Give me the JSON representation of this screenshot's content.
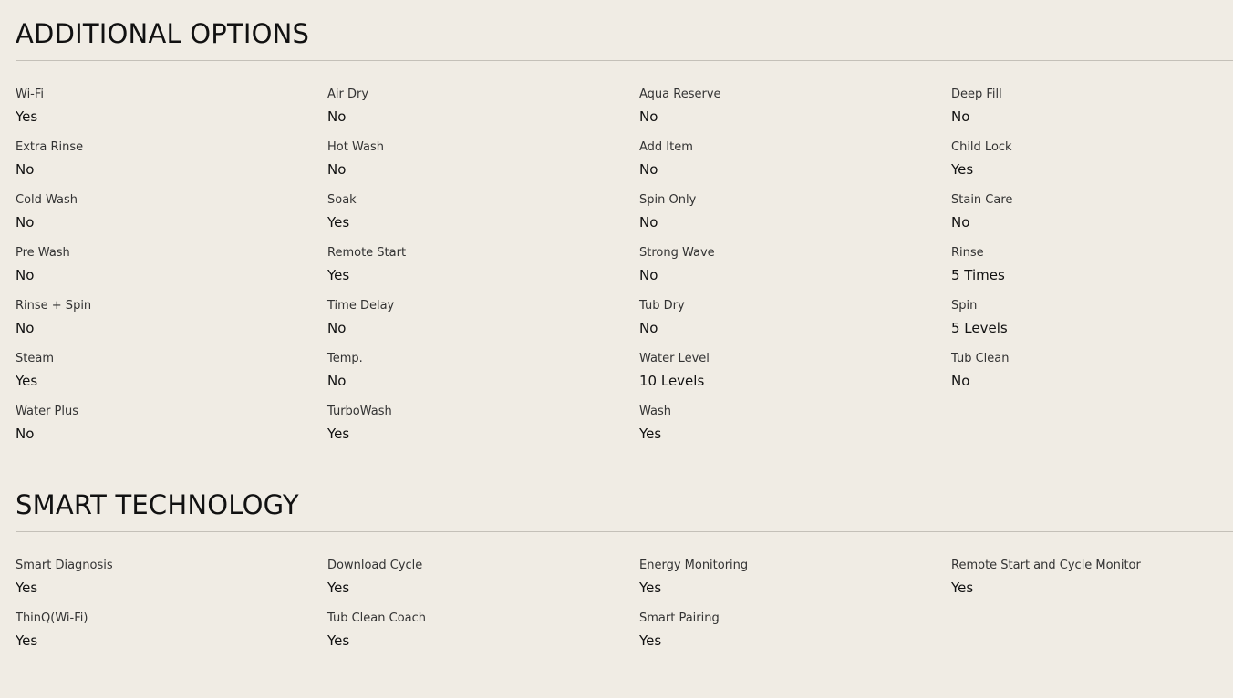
{
  "additional_options": {
    "title": "ADDITIONAL OPTIONS",
    "items": [
      {
        "label": "Wi-Fi",
        "value": "Yes"
      },
      {
        "label": "Air Dry",
        "value": "No"
      },
      {
        "label": "Aqua Reserve",
        "value": "No"
      },
      {
        "label": "Deep Fill",
        "value": "No"
      },
      {
        "label": "Extra Rinse",
        "value": "No"
      },
      {
        "label": "Hot Wash",
        "value": "No"
      },
      {
        "label": "Add Item",
        "value": "No"
      },
      {
        "label": "Child Lock",
        "value": "Yes"
      },
      {
        "label": "Cold Wash",
        "value": "No"
      },
      {
        "label": "Soak",
        "value": "Yes"
      },
      {
        "label": "Spin Only",
        "value": "No"
      },
      {
        "label": "Stain Care",
        "value": "No"
      },
      {
        "label": "Pre Wash",
        "value": "No"
      },
      {
        "label": "Remote Start",
        "value": "Yes"
      },
      {
        "label": "Strong Wave",
        "value": "No"
      },
      {
        "label": "Rinse",
        "value": "5 Times"
      },
      {
        "label": "Rinse + Spin",
        "value": "No"
      },
      {
        "label": "Time Delay",
        "value": "No"
      },
      {
        "label": "Tub Dry",
        "value": "No"
      },
      {
        "label": "Spin",
        "value": "5 Levels"
      },
      {
        "label": "Steam",
        "value": "Yes"
      },
      {
        "label": "Temp.",
        "value": "No"
      },
      {
        "label": "Water Level",
        "value": "10 Levels"
      },
      {
        "label": "Tub Clean",
        "value": "No"
      },
      {
        "label": "Water Plus",
        "value": "No"
      },
      {
        "label": "TurboWash",
        "value": "Yes"
      },
      {
        "label": "Wash",
        "value": "Yes"
      }
    ]
  },
  "smart_technology": {
    "title": "SMART TECHNOLOGY",
    "items": [
      {
        "label": "Smart Diagnosis",
        "value": "Yes"
      },
      {
        "label": "Download Cycle",
        "value": "Yes"
      },
      {
        "label": "Energy Monitoring",
        "value": "Yes"
      },
      {
        "label": "Remote Start and Cycle Monitor",
        "value": "Yes"
      },
      {
        "label": "ThinQ(Wi-Fi)",
        "value": "Yes"
      },
      {
        "label": "Tub Clean Coach",
        "value": "Yes"
      },
      {
        "label": "Smart Pairing",
        "value": "Yes"
      }
    ]
  },
  "colors": {
    "background": "#f0ece4",
    "text": "#111111",
    "label": "#333333",
    "rule": "#c4c0b8"
  }
}
